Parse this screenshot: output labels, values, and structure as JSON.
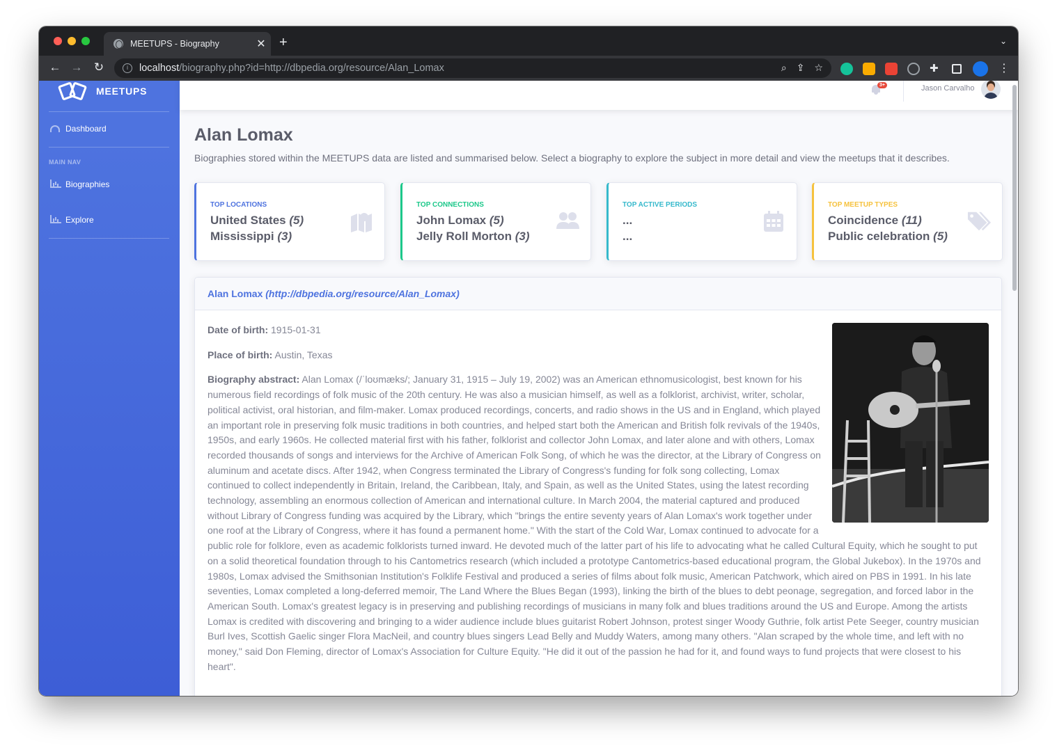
{
  "browser": {
    "tab_title": "MEETUPS - Biography",
    "url_host": "localhost",
    "url_path": "/biography.php?id=http://dbpedia.org/resource/Alan_Lomax"
  },
  "sidebar": {
    "brand": "MEETUPS",
    "dashboard": "Dashboard",
    "heading": "MAIN NAV",
    "items": [
      {
        "label": "Biographies",
        "icon": "chart-area-icon"
      },
      {
        "label": "Explore",
        "icon": "chart-area-icon"
      }
    ]
  },
  "topbar": {
    "badge": "3+",
    "user_name": "Jason Carvalho"
  },
  "page": {
    "title": "Alan Lomax",
    "description": "Biographies stored within the MEETUPS data are listed and summarised below. Select a biography to explore the subject in more detail and view the meetups that it describes."
  },
  "cards": [
    {
      "label": "Top Locations",
      "lines": [
        {
          "name": "United States",
          "count": "(5)"
        },
        {
          "name": "Mississippi",
          "count": "(3)"
        }
      ],
      "color": "#4e73df",
      "icon": "map-icon"
    },
    {
      "label": "Top Connections",
      "lines": [
        {
          "name": "John Lomax",
          "count": "(5)"
        },
        {
          "name": "Jelly Roll Morton",
          "count": "(3)"
        }
      ],
      "color": "#1cc88a",
      "icon": "users-icon"
    },
    {
      "label": "Top Active Periods",
      "lines": [
        {
          "name": "...",
          "count": ""
        },
        {
          "name": "...",
          "count": ""
        }
      ],
      "color": "#36b9cc",
      "icon": "calendar-icon"
    },
    {
      "label": "Top Meetup Types",
      "lines": [
        {
          "name": "Coincidence",
          "count": "(11)"
        },
        {
          "name": "Public celebration",
          "count": "(5)"
        }
      ],
      "color": "#f6c23e",
      "icon": "tags-icon"
    }
  ],
  "bio": {
    "header_name": "Alan Lomax",
    "header_uri": "(http://dbpedia.org/resource/Alan_Lomax)",
    "dob_label": "Date of birth:",
    "dob": "1915-01-31",
    "pob_label": "Place of birth:",
    "pob": "Austin, Texas",
    "abstract_label": "Biography abstract:",
    "abstract": "Alan Lomax (/ˈloʊmæks/; January 31, 1915 – July 19, 2002) was an American ethnomusicologist, best known for his numerous field recordings of folk music of the 20th century. He was also a musician himself, as well as a folklorist, archivist, writer, scholar, political activist, oral historian, and film-maker. Lomax produced recordings, concerts, and radio shows in the US and in England, which played an important role in preserving folk music traditions in both countries, and helped start both the American and British folk revivals of the 1940s, 1950s, and early 1960s. He collected material first with his father, folklorist and collector John Lomax, and later alone and with others, Lomax recorded thousands of songs and interviews for the Archive of American Folk Song, of which he was the director, at the Library of Congress on aluminum and acetate discs. After 1942, when Congress terminated the Library of Congress's funding for folk song collecting, Lomax continued to collect independently in Britain, Ireland, the Caribbean, Italy, and Spain, as well as the United States, using the latest recording technology, assembling an enormous collection of American and international culture. In March 2004, the material captured and produced without Library of Congress funding was acquired by the Library, which \"brings the entire seventy years of Alan Lomax's work together under one roof at the Library of Congress, where it has found a permanent home.\" With the start of the Cold War, Lomax continued to advocate for a public role for folklore, even as academic folklorists turned inward. He devoted much of the latter part of his life to advocating what he called Cultural Equity, which he sought to put on a solid theoretical foundation through to his Cantometrics research (which included a prototype Cantometrics-based educational program, the Global Jukebox). In the 1970s and 1980s, Lomax advised the Smithsonian Institution's Folklife Festival and produced a series of films about folk music, American Patchwork, which aired on PBS in 1991. In his late seventies, Lomax completed a long-deferred memoir, The Land Where the Blues Began (1993), linking the birth of the blues to debt peonage, segregation, and forced labor in the American South. Lomax's greatest legacy is in preserving and publishing recordings of musicians in many folk and blues traditions around the US and Europe. Among the artists Lomax is credited with discovering and bringing to a wider audience include blues guitarist Robert Johnson, protest singer Woody Guthrie, folk artist Pete Seeger, country musician Burl Ives, Scottish Gaelic singer Flora MacNeil, and country blues singers Lead Belly and Muddy Waters, among many others. \"Alan scraped by the whole time, and left with no money,\" said Don Fleming, director of Lomax's Association for Culture Equity. \"He did it out of the passion he had for it, and found ways to fund projects that were closest to his heart\"."
  }
}
